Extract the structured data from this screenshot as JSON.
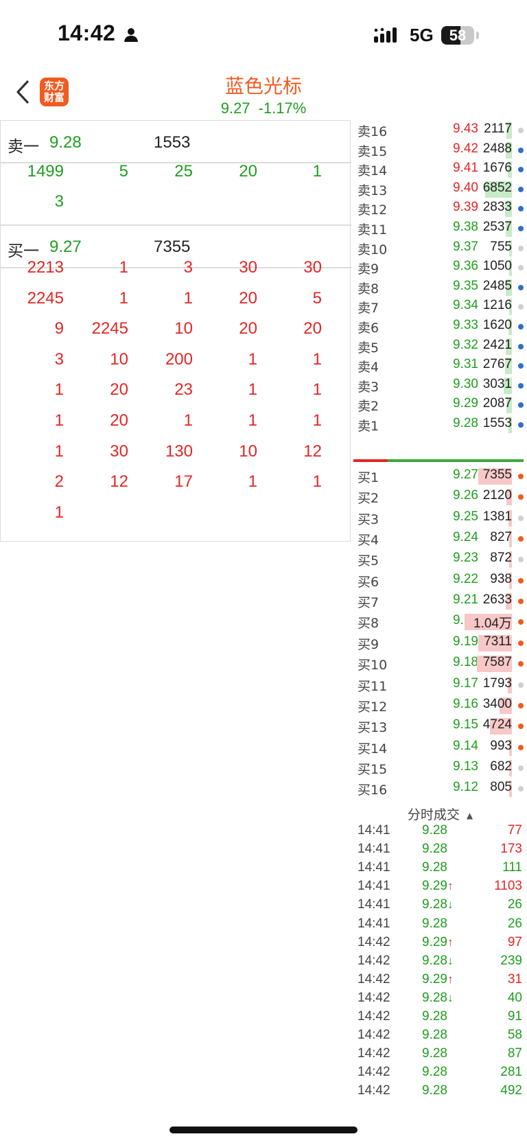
{
  "status_bar": {
    "time": "14:42",
    "network": "5G",
    "battery": "58",
    "battery_level": 0.58
  },
  "header": {
    "title": "蓝色光标",
    "price": "9.27",
    "change_pct": "-1.17%",
    "app_logo_line1": "东方",
    "app_logo_line2": "财富"
  },
  "colors": {
    "up": "#e42525",
    "down": "#1e9e1e",
    "brand": "#f05b22",
    "ask_bar": "#c7ebc7",
    "bid_bar": "#f8c8c8",
    "dot_blue": "#2f6fc9",
    "dot_orange": "#f05b22",
    "dot_gray": "#d0d0d0"
  },
  "left": {
    "ask1": {
      "label": "卖一",
      "price": "9.28",
      "volume": "1553"
    },
    "ask_queue": [
      "1499",
      "5",
      "25",
      "20",
      "1",
      "3"
    ],
    "bid1": {
      "label": "买一",
      "price": "9.27",
      "volume": "7355"
    },
    "bid_queue": [
      "2213",
      "1",
      "3",
      "30",
      "30",
      "2245",
      "1",
      "1",
      "20",
      "5",
      "9",
      "2245",
      "10",
      "20",
      "20",
      "3",
      "10",
      "200",
      "1",
      "1",
      "1",
      "20",
      "23",
      "1",
      "1",
      "1",
      "20",
      "1",
      "1",
      "1",
      "1",
      "30",
      "130",
      "10",
      "12",
      "2",
      "12",
      "17",
      "1",
      "1",
      "1"
    ]
  },
  "order_book": {
    "asks": [
      {
        "label": "卖16",
        "price": "9.43",
        "volume": "2117",
        "bar": 0.06,
        "dot": "gray",
        "up": true
      },
      {
        "label": "卖15",
        "price": "9.42",
        "volume": "2488",
        "bar": 0.07,
        "dot": "blue",
        "up": true
      },
      {
        "label": "卖14",
        "price": "9.41",
        "volume": "1676",
        "bar": 0.05,
        "dot": "blue",
        "up": true
      },
      {
        "label": "卖13",
        "price": "9.40",
        "volume": "6852",
        "bar": 0.3,
        "dot": "blue",
        "up": true
      },
      {
        "label": "卖12",
        "price": "9.39",
        "volume": "2833",
        "bar": 0.08,
        "dot": "blue",
        "up": true
      },
      {
        "label": "卖11",
        "price": "9.38",
        "volume": "2537",
        "bar": 0.07,
        "dot": "blue",
        "up": false
      },
      {
        "label": "卖10",
        "price": "9.37",
        "volume": "755",
        "bar": 0.02,
        "dot": "gray",
        "up": false
      },
      {
        "label": "卖9",
        "price": "9.36",
        "volume": "1050",
        "bar": 0.03,
        "dot": "gray",
        "up": false
      },
      {
        "label": "卖8",
        "price": "9.35",
        "volume": "2485",
        "bar": 0.07,
        "dot": "blue",
        "up": false
      },
      {
        "label": "卖7",
        "price": "9.34",
        "volume": "1216",
        "bar": 0.03,
        "dot": "gray",
        "up": false
      },
      {
        "label": "卖6",
        "price": "9.33",
        "volume": "1620",
        "bar": 0.04,
        "dot": "blue",
        "up": false
      },
      {
        "label": "卖5",
        "price": "9.32",
        "volume": "2421",
        "bar": 0.07,
        "dot": "blue",
        "up": false
      },
      {
        "label": "卖4",
        "price": "9.31",
        "volume": "2767",
        "bar": 0.08,
        "dot": "blue",
        "up": false
      },
      {
        "label": "卖3",
        "price": "9.30",
        "volume": "3031",
        "bar": 0.09,
        "dot": "blue",
        "up": false
      },
      {
        "label": "卖2",
        "price": "9.29",
        "volume": "2087",
        "bar": 0.06,
        "dot": "blue",
        "up": false
      },
      {
        "label": "卖1",
        "price": "9.28",
        "volume": "1553",
        "bar": 0.04,
        "dot": "blue",
        "up": false
      }
    ],
    "bids": [
      {
        "label": "买1",
        "price": "9.27",
        "volume": "7355",
        "bar": 0.38,
        "dot": "orange"
      },
      {
        "label": "买2",
        "price": "9.26",
        "volume": "2120",
        "bar": 0.06,
        "dot": "orange"
      },
      {
        "label": "买3",
        "price": "9.25",
        "volume": "1381",
        "bar": 0.04,
        "dot": "gray"
      },
      {
        "label": "买4",
        "price": "9.24",
        "volume": "827",
        "bar": 0.02,
        "dot": "orange"
      },
      {
        "label": "买5",
        "price": "9.23",
        "volume": "872",
        "bar": 0.02,
        "dot": "gray"
      },
      {
        "label": "买6",
        "price": "9.22",
        "volume": "938",
        "bar": 0.02,
        "dot": "orange"
      },
      {
        "label": "买7",
        "price": "9.21",
        "volume": "2633",
        "bar": 0.07,
        "dot": "orange"
      },
      {
        "label": "买8",
        "price": "9.20",
        "volume": "1.04万",
        "bar": 0.53,
        "dot": "orange"
      },
      {
        "label": "买9",
        "price": "9.19",
        "volume": "7311",
        "bar": 0.38,
        "dot": "orange"
      },
      {
        "label": "买10",
        "price": "9.18",
        "volume": "7587",
        "bar": 0.39,
        "dot": "orange"
      },
      {
        "label": "买11",
        "price": "9.17",
        "volume": "1793",
        "bar": 0.05,
        "dot": "gray"
      },
      {
        "label": "买12",
        "price": "9.16",
        "volume": "3400",
        "bar": 0.14,
        "dot": "orange"
      },
      {
        "label": "买13",
        "price": "9.15",
        "volume": "4724",
        "bar": 0.25,
        "dot": "orange"
      },
      {
        "label": "买14",
        "price": "9.14",
        "volume": "993",
        "bar": 0.02,
        "dot": "orange"
      },
      {
        "label": "买15",
        "price": "9.13",
        "volume": "682",
        "bar": 0.02,
        "dot": "gray"
      },
      {
        "label": "买16",
        "price": "9.12",
        "volume": "805",
        "bar": 0.02,
        "dot": "gray"
      }
    ],
    "buy_ratio": 0.2
  },
  "trades": {
    "title": "分时成交",
    "rows": [
      {
        "time": "14:41",
        "price": "9.28",
        "arrow": "",
        "volume": "77",
        "side": "buy"
      },
      {
        "time": "14:41",
        "price": "9.28",
        "arrow": "",
        "volume": "173",
        "side": "buy"
      },
      {
        "time": "14:41",
        "price": "9.28",
        "arrow": "",
        "volume": "111",
        "side": "sell"
      },
      {
        "time": "14:41",
        "price": "9.29",
        "arrow": "↑",
        "volume": "1103",
        "side": "buy"
      },
      {
        "time": "14:41",
        "price": "9.28",
        "arrow": "↓",
        "volume": "26",
        "side": "sell"
      },
      {
        "time": "14:41",
        "price": "9.28",
        "arrow": "",
        "volume": "26",
        "side": "sell"
      },
      {
        "time": "14:42",
        "price": "9.29",
        "arrow": "↑",
        "volume": "97",
        "side": "buy"
      },
      {
        "time": "14:42",
        "price": "9.28",
        "arrow": "↓",
        "volume": "239",
        "side": "sell"
      },
      {
        "time": "14:42",
        "price": "9.29",
        "arrow": "↑",
        "volume": "31",
        "side": "buy"
      },
      {
        "time": "14:42",
        "price": "9.28",
        "arrow": "↓",
        "volume": "40",
        "side": "sell"
      },
      {
        "time": "14:42",
        "price": "9.28",
        "arrow": "",
        "volume": "91",
        "side": "sell"
      },
      {
        "time": "14:42",
        "price": "9.28",
        "arrow": "",
        "volume": "58",
        "side": "sell"
      },
      {
        "time": "14:42",
        "price": "9.28",
        "arrow": "",
        "volume": "87",
        "side": "sell"
      },
      {
        "time": "14:42",
        "price": "9.28",
        "arrow": "",
        "volume": "281",
        "side": "sell"
      },
      {
        "time": "14:42",
        "price": "9.28",
        "arrow": "",
        "volume": "492",
        "side": "sell"
      }
    ]
  }
}
